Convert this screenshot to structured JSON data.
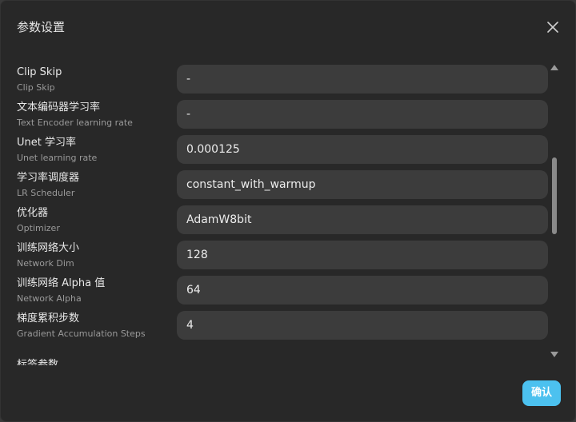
{
  "dialog": {
    "title": "参数设置",
    "close_icon": "close-icon",
    "confirm_label": "确认"
  },
  "params": [
    {
      "label": "Clip Skip",
      "sublabel": "Clip Skip",
      "value": "-"
    },
    {
      "label": "文本编码器学习率",
      "sublabel": "Text Encoder learning rate",
      "value": "-"
    },
    {
      "label": "Unet 学习率",
      "sublabel": "Unet learning rate",
      "value": "0.000125"
    },
    {
      "label": "学习率调度器",
      "sublabel": "LR Scheduler",
      "value": "constant_with_warmup"
    },
    {
      "label": "优化器",
      "sublabel": "Optimizer",
      "value": "AdamW8bit"
    },
    {
      "label": "训练网络大小",
      "sublabel": "Network Dim",
      "value": "128"
    },
    {
      "label": "训练网络 Alpha 值",
      "sublabel": "Network Alpha",
      "value": "64"
    },
    {
      "label": "梯度累积步数",
      "sublabel": "Gradient Accumulation Steps",
      "value": "4"
    }
  ],
  "next_section_label": "标签参数",
  "colors": {
    "background": "#282828",
    "field": "#3c3c3c",
    "accent": "#4cc1ef"
  }
}
